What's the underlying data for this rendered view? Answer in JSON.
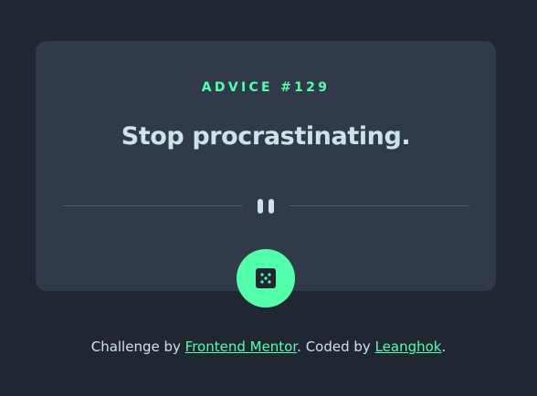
{
  "card": {
    "advice_label": "ADVICE #129",
    "advice_text": "Stop procrastinating.",
    "divider_icon": "pause-icon",
    "dice_icon": "dice-icon"
  },
  "attribution": {
    "prefix": "Challenge by ",
    "challenge_link": "Frontend Mentor",
    "middle": ". Coded by ",
    "author_link": "Leanghok",
    "suffix": "."
  },
  "colors": {
    "background": "#202733",
    "card": "#313a48",
    "accent": "#53ffaa",
    "text": "#cee3e9",
    "divider": "#4f5d74"
  }
}
